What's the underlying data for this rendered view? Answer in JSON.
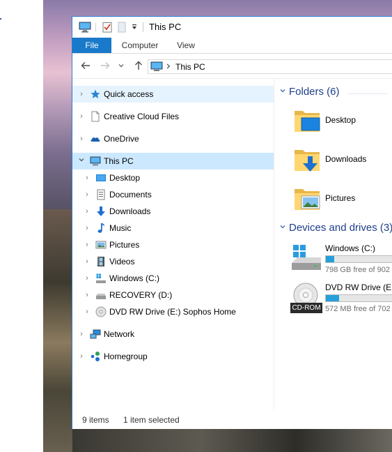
{
  "window": {
    "title": "This PC",
    "colors": {
      "accent": "#1979ca",
      "selection": "#cce8ff",
      "group_title": "#1e3f8a",
      "drive_bar": "#26a0da"
    }
  },
  "quick_access_toolbar": {
    "icons": [
      "computer-icon",
      "properties-checkmark-icon",
      "new-folder-icon",
      "customize-dropdown-icon"
    ]
  },
  "ribbon": {
    "tabs": [
      {
        "label": "File",
        "active": true
      },
      {
        "label": "Computer"
      },
      {
        "label": "View"
      }
    ]
  },
  "address": {
    "path": "This PC",
    "icons": [
      "back-arrow-icon",
      "forward-arrow-icon",
      "recent-locations-dropdown-icon",
      "up-arrow-icon"
    ]
  },
  "nav_pane": {
    "items": [
      {
        "label": "Quick access",
        "icon": "star-icon",
        "selected": "hover"
      },
      {
        "label": "Creative Cloud Files",
        "icon": "document-icon"
      },
      {
        "label": "OneDrive",
        "icon": "cloud-icon"
      },
      {
        "label": "This PC",
        "icon": "computer-icon",
        "selected": true,
        "expanded": true
      },
      {
        "label": "Desktop",
        "icon": "desktop-icon"
      },
      {
        "label": "Documents",
        "icon": "documents-icon"
      },
      {
        "label": "Downloads",
        "icon": "download-arrow-icon"
      },
      {
        "label": "Music",
        "icon": "music-note-icon"
      },
      {
        "label": "Pictures",
        "icon": "pictures-icon"
      },
      {
        "label": "Videos",
        "icon": "film-icon"
      },
      {
        "label": "Windows (C:)",
        "icon": "hard-drive-icon"
      },
      {
        "label": "RECOVERY (D:)",
        "icon": "hard-drive-icon"
      },
      {
        "label": "DVD RW Drive (E:) Sophos Home",
        "icon": "disc-icon"
      },
      {
        "label": "Network",
        "icon": "network-icon"
      },
      {
        "label": "Homegroup",
        "icon": "homegroup-icon"
      }
    ]
  },
  "content": {
    "folders_group": {
      "title": "Folders (6)"
    },
    "folders": [
      {
        "name": "Desktop",
        "icon": "folder-desktop-icon"
      },
      {
        "name": "Downloads",
        "icon": "folder-downloads-icon"
      },
      {
        "name": "Pictures",
        "icon": "folder-pictures-icon"
      }
    ],
    "drives_group": {
      "title": "Devices and drives (3)"
    },
    "drives": [
      {
        "name": "Windows (C:)",
        "free": "798 GB free of 902",
        "used_fraction": 0.12,
        "icon": "windows-drive-icon"
      },
      {
        "name": "DVD RW Drive (E:)",
        "free": "572 MB free of 702",
        "used_fraction": 0.19,
        "icon": "cd-rom-drive-icon",
        "badge": "CD-ROM"
      }
    ]
  },
  "status": {
    "item_count": "9 items",
    "selection": "1 item selected"
  }
}
